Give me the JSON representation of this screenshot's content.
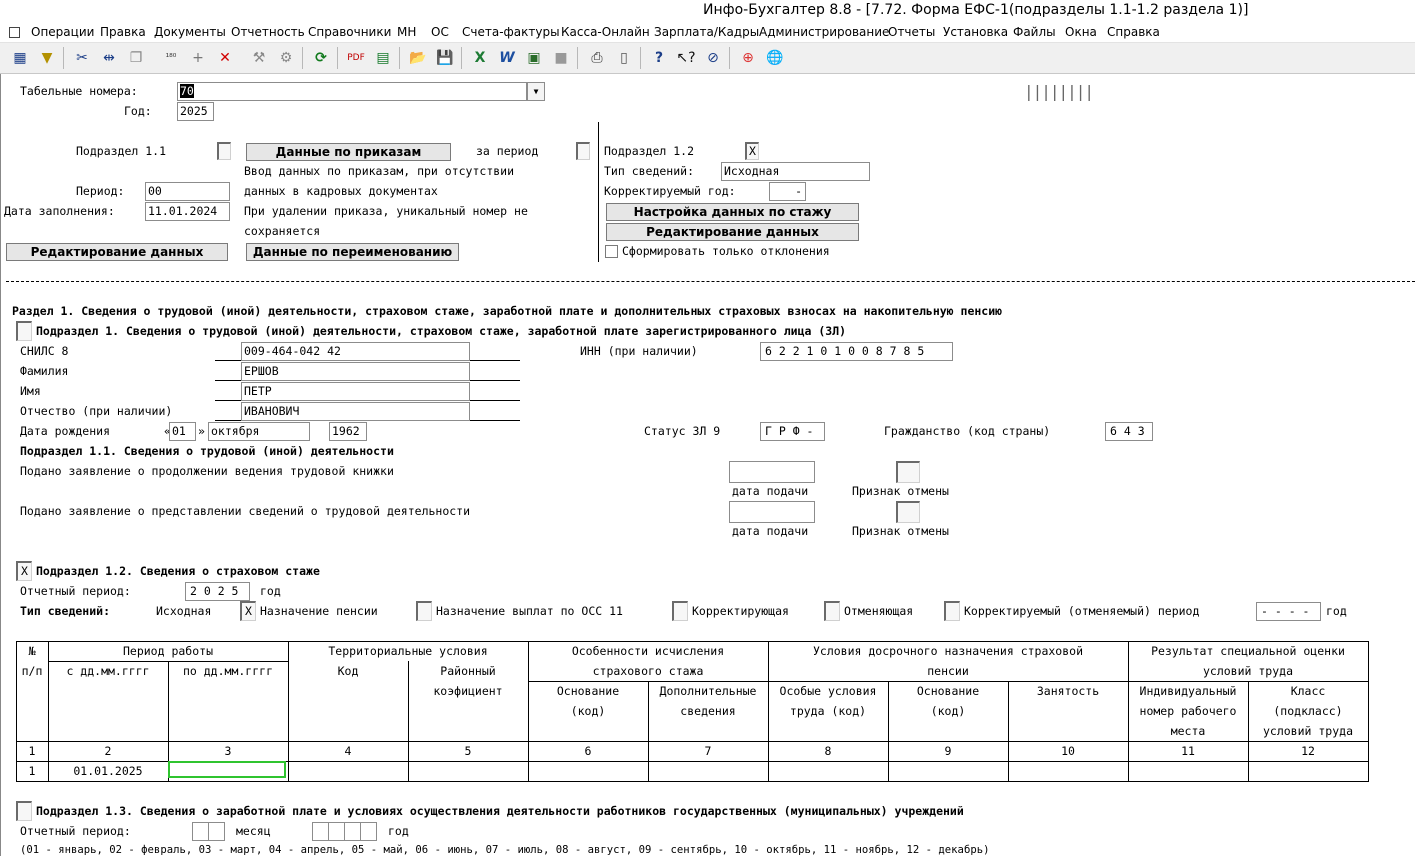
{
  "window": {
    "title": "Инфо-Бухгалтер 8.8 - [7.72.    Форма ЕФС-1(подразделы 1.1-1.2 раздела 1)]"
  },
  "menu": [
    "Операции",
    "Правка",
    "Документы",
    "Отчетность",
    "Справочники",
    "МН",
    "ОС",
    "Счета-фактуры",
    "Касса-Онлайн",
    "Зарплата/Кадры",
    "Администрирование",
    "Отчеты",
    "Установка",
    "Файлы",
    "Окна",
    "Справка"
  ],
  "toolbar": {
    "icons": [
      "grid-icon",
      "filter-icon",
      "cut-icon",
      "split-icon",
      "copy-icon",
      "number-icon",
      "add-icon",
      "delete-icon",
      "hammer-icon",
      "tools-icon",
      "refresh-icon",
      "pdf-icon",
      "calculator-icon",
      "open-folder-icon",
      "save-icon",
      "excel-icon",
      "word-icon",
      "export-icon",
      "gray-icon",
      "print-icon",
      "preview-icon",
      "help-icon",
      "context-help-icon",
      "compass-icon",
      "lifebuoy-icon",
      "globe-icon"
    ]
  },
  "header": {
    "tab_numbers_label": "Табельные номера:",
    "tab_numbers_value": "70",
    "year_label": "Год:",
    "year_value": "2025",
    "ruler": "||||||||"
  },
  "sub11": {
    "label": "Подраздел 1.1",
    "orders_button": "Данные по приказам",
    "for_period": "за период",
    "hint1": "Ввод данных по приказам, при отсутствии",
    "hint2": "данных в кадровых документах",
    "hint3": "При удалении приказа, уникальный номер не",
    "hint4": "сохраняется",
    "period_label": "Период:",
    "period_value": "00",
    "fill_date_label": "Дата заполнения:",
    "fill_date_value": "11.01.2024",
    "edit_button": "Редактирование данных",
    "rename_button": "Данные по переименованию"
  },
  "sub12": {
    "label": "Подраздел 1.2",
    "checkbox": "X",
    "info_type_label": "Тип сведений:",
    "info_type_value": "Исходная",
    "corr_year_label": "Корректируемый год:",
    "corr_year_value": "-",
    "seniority_button": "Настройка данных по стажу",
    "edit_button": "Редактирование данных",
    "deviations_label": "Сформировать только отклонения"
  },
  "section1": {
    "title": "Раздел 1. Сведения о трудовой (иной) деятельности, страховом стаже, заработной плате и дополнительных страховых взносах на накопительную пенсию",
    "sub1_title": "Подраздел 1. Сведения о трудовой (иной) деятельности, страховом стаже, заработной плате зарегистрированного лица (ЗЛ)",
    "snils_label": "СНИЛС  8",
    "snils_value": "009-464-042 42",
    "surname_label": "Фамилия",
    "surname_value": "ЕРШОВ",
    "name_label": "Имя",
    "name_value": "ПЕТР",
    "patronymic_label": "Отчество (при наличии)",
    "patronymic_value": "ИВАНОВИЧ",
    "birth_label": "Дата рождения",
    "birth_quote": "«",
    "birth_day": "01",
    "birth_quote2": "»",
    "birth_month": "октября",
    "birth_year": "1962",
    "inn_label": "ИНН (при наличии)",
    "inn_value": "6 2 2 1 0 1 0 0 8 7 8 5",
    "status_label": "Статус ЗЛ  9",
    "status_value": "Г Р Ф -",
    "citizenship_label": "Гражданство (код страны)",
    "citizenship_value": "6 4 3"
  },
  "sub1_1": {
    "title": "Подраздел 1.1. Сведения о трудовой (иной) деятельности",
    "row1": "Подано заявление о продолжении ведения трудовой книжки",
    "row2": "Подано заявление о представлении сведений о трудовой деятельности",
    "date_label": "дата подачи",
    "cancel_label": "Признак отмены"
  },
  "sub1_2": {
    "checkbox": "X",
    "title": "Подраздел 1.2. Сведения о страховом стаже",
    "period_label": "Отчетный период:",
    "period_value": "2 0 2 5",
    "year_word": "год",
    "info_type_label": "Тип сведений:",
    "info_type_value": "Исходная",
    "pension_check": "X",
    "pension_label": "Назначение пенсии",
    "oss_label": "Назначение выплат по ОСС  11",
    "corrective_label": "Корректирующая",
    "cancelling_label": "Отменяющая",
    "corr_period_label": "Корректируемый (отменяемый) период",
    "corr_period_value": "- - - -",
    "year_word2": "год"
  },
  "table": {
    "h_num": "№",
    "h_num2": "п/п",
    "h_period": "Период работы",
    "h_from": "с дд.мм.гггг",
    "h_to": "по дд.мм.гггг",
    "h_terr": "Территориальные условия",
    "h_code": "Код",
    "h_coef1": "Районный",
    "h_coef2": "коэфициент",
    "h_calc1": "Особенности исчисления",
    "h_calc2": "страхового стажа",
    "h_basis1": "Основание",
    "h_basis2": "(код)",
    "h_add1": "Дополнительные",
    "h_add2": "сведения",
    "h_early1": "Условия досрочного назначения страховой",
    "h_early2": "пенсии",
    "h_special1": "Особые условия",
    "h_special2": "труда (код)",
    "h_ebasis1": "Основание",
    "h_ebasis2": "(код)",
    "h_employ": "Занятость",
    "h_result1": "Результат специальной оценки",
    "h_result2": "условий труда",
    "h_indiv1": "Индивидуальный",
    "h_indiv2": "номер рабочего",
    "h_indiv3": "места",
    "h_class1": "Класс",
    "h_class2": "(подкласс)",
    "h_class3": "условий труда",
    "col_numbers": [
      "1",
      "2",
      "3",
      "4",
      "5",
      "6",
      "7",
      "8",
      "9",
      "10",
      "11",
      "12"
    ],
    "rows": [
      {
        "n": "1",
        "from": "01.01.2025",
        "to": ""
      }
    ]
  },
  "sub1_3": {
    "title": "Подраздел 1.3. Сведения о заработной плате и условиях осуществления деятельности работников государственных (муниципальных) учреждений",
    "period_label": "Отчетный период:",
    "month_word": "месяц",
    "year_word": "год",
    "months_hint": "(01 - январь, 02 - февраль, 03 - март, 04 - апрель, 05 - май, 06 - июнь, 07 - июль, 08 - август, 09 - сентябрь, 10 - октябрь, 11 - ноябрь, 12 - декабрь)"
  }
}
